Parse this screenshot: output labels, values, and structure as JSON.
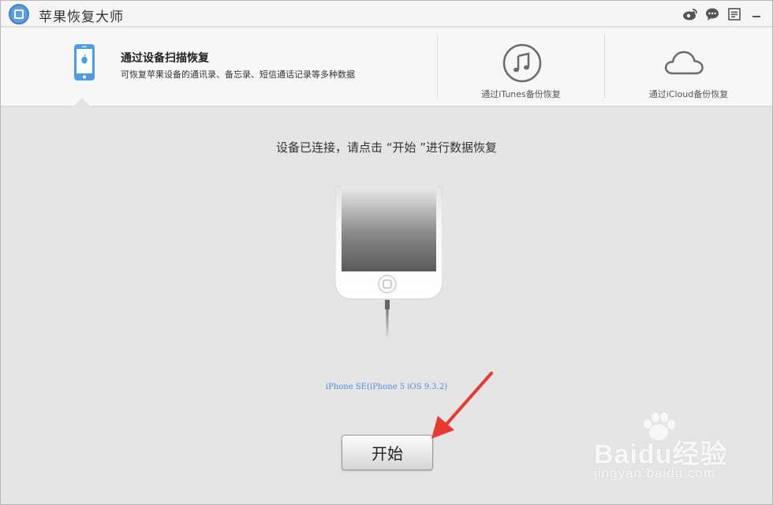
{
  "window": {
    "title": "苹果恢复大师",
    "icons": [
      "weibo-icon",
      "chat-icon",
      "menu-icon",
      "minimize-icon"
    ]
  },
  "tabs": [
    {
      "title": "通过设备扫描恢复",
      "description": "可恢复苹果设备的通讯录、备忘录、短信通话记录等多种数据",
      "icon": "phone-icon",
      "active": true
    },
    {
      "label": "通过iTunes备份恢复",
      "icon": "itunes-music-icon",
      "active": false
    },
    {
      "label": "通过iCloud备份恢复",
      "icon": "cloud-icon",
      "active": false
    }
  ],
  "main": {
    "status_message": "设备已连接，请点击 “开始 ”进行数据恢复",
    "device_name": "iPhone SE(iPhone 5 iOS 9.3.2)",
    "start_button": "开始"
  },
  "watermark": {
    "brand": "Baidu经验",
    "url": "jingyan.baidu.com"
  },
  "colors": {
    "accent": "#4a8fd8",
    "annotation_arrow": "#e8382f"
  }
}
